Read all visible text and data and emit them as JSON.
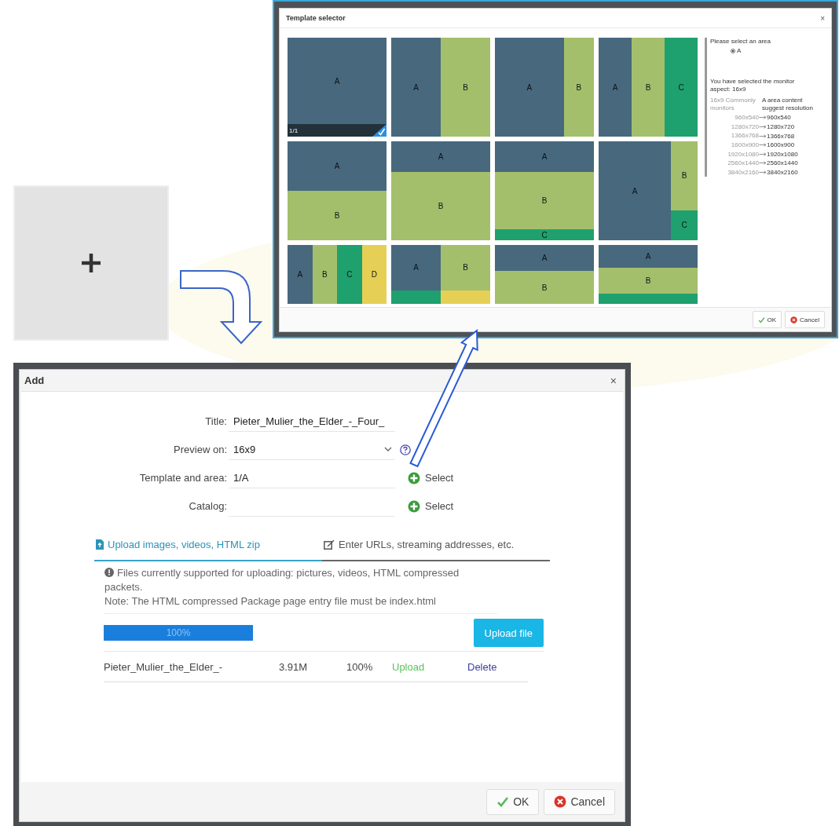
{
  "template_selector": {
    "title": "Template selector",
    "close": "×",
    "templates": [
      {
        "kind": "full",
        "selected": true,
        "badge": "1/1",
        "areas": [
          {
            "label": "A",
            "color": "#48687e"
          }
        ]
      },
      {
        "kind": "halves",
        "selected": false,
        "areas": [
          {
            "label": "A",
            "color": "#48687e"
          },
          {
            "label": "B",
            "color": "#a4bf6b"
          }
        ]
      },
      {
        "kind": "wideleft",
        "selected": false,
        "areas": [
          {
            "label": "A",
            "color": "#48687e"
          },
          {
            "label": "B",
            "color": "#a4bf6b"
          }
        ]
      },
      {
        "kind": "thirds",
        "selected": false,
        "areas": [
          {
            "label": "A",
            "color": "#48687e"
          },
          {
            "label": "B",
            "color": "#a4bf6b"
          },
          {
            "label": "C",
            "color": "#1fa06f"
          }
        ]
      },
      {
        "kind": "stacked",
        "selected": false,
        "areas": [
          {
            "label": "A",
            "color": "#48687e"
          },
          {
            "label": "B",
            "color": "#a4bf6b"
          }
        ]
      },
      {
        "kind": "topbar",
        "selected": false,
        "areas": [
          {
            "label": "A",
            "color": "#48687e"
          },
          {
            "label": "B",
            "color": "#a4bf6b"
          }
        ]
      },
      {
        "kind": "banded",
        "selected": false,
        "areas": [
          {
            "label": "A",
            "color": "#48687e"
          },
          {
            "label": "B",
            "color": "#a4bf6b"
          },
          {
            "label": "C",
            "color": "#1fa06f"
          }
        ]
      },
      {
        "kind": "sidestack",
        "selected": false,
        "areas": [
          {
            "label": "A",
            "color": "#48687e"
          },
          {
            "label": "B",
            "color": "#a4bf6b"
          },
          {
            "label": "C",
            "color": "#1fa06f"
          }
        ]
      },
      {
        "kind": "quarters",
        "selected": false,
        "areas": [
          {
            "label": "A",
            "color": "#48687e"
          },
          {
            "label": "B",
            "color": "#a4bf6b"
          },
          {
            "label": "C",
            "color": "#1fa06f"
          },
          {
            "label": "D",
            "color": "#e6cf55"
          }
        ]
      },
      {
        "kind": "footersplit",
        "selected": false,
        "areas": [
          {
            "label": "A",
            "color": "#48687e"
          },
          {
            "label": "B",
            "color": "#a4bf6b"
          },
          {
            "color": "#1fa06f"
          },
          {
            "color": "#e6cf55"
          }
        ]
      },
      {
        "kind": "upperlower",
        "selected": false,
        "areas": [
          {
            "label": "A",
            "color": "#48687e"
          },
          {
            "label": "B",
            "color": "#a4bf6b"
          }
        ]
      },
      {
        "kind": "threebands",
        "selected": false,
        "areas": [
          {
            "label": "A",
            "color": "#48687e"
          },
          {
            "label": "B",
            "color": "#a4bf6b"
          },
          {
            "color": "#1fa06f"
          }
        ]
      }
    ],
    "area_prompt": "Please select an area",
    "areas": [
      {
        "label": "A",
        "selected": true
      }
    ],
    "aspect_text": "You have selected the monitor aspect: 16x9",
    "resolution_table": {
      "columns": [
        "16x9 Commonly monitors",
        "A area content suggest resolution"
      ],
      "rows": [
        {
          "monitor": "960x540",
          "resolution": "960x540"
        },
        {
          "monitor": "1280x720",
          "resolution": "1280x720"
        },
        {
          "monitor": "1366x768",
          "resolution": "1366x768"
        },
        {
          "monitor": "1600x900",
          "resolution": "1600x900"
        },
        {
          "monitor": "1920x1080",
          "resolution": "1920x1080"
        },
        {
          "monitor": "2560x1440",
          "resolution": "2560x1440"
        },
        {
          "monitor": "3840x2160",
          "resolution": "3840x2160"
        }
      ]
    },
    "buttons": [
      {
        "label": "OK",
        "kind": "ok"
      },
      {
        "label": "Cancel",
        "kind": "cancel"
      }
    ]
  },
  "add_dialog": {
    "title": "Add",
    "close": "×",
    "fields": [
      {
        "label": "Title:",
        "kind": "text",
        "value": "Pieter_Mulier_the_Elder_-_Four_"
      },
      {
        "label": "Preview on:",
        "kind": "select",
        "value": "16x9"
      },
      {
        "label": "Template and area:",
        "kind": "picker",
        "value": "1/A",
        "action": "Select"
      },
      {
        "label": "Catalog:",
        "kind": "picker",
        "action": "Select"
      }
    ],
    "tabs": [
      {
        "label": "Upload images, videos, HTML zip",
        "kind": "upload",
        "selected": true
      },
      {
        "label": "Enter URLs, streaming addresses, etc.",
        "kind": "edit",
        "selected": false
      }
    ],
    "info": "Files currently supported for uploading: pictures, videos, HTML compressed packets.",
    "note": "Note: The HTML compressed Package page entry file must be index.html",
    "progress": {
      "level": 1,
      "reading": "100%"
    },
    "upload_button": "Upload file",
    "files": [
      {
        "name": "Pieter_Mulier_the_Elder_-",
        "size": "3.91M",
        "percent": "100%",
        "status": "Upload",
        "action": "Delete"
      }
    ],
    "buttons": [
      {
        "label": "OK",
        "kind": "ok"
      },
      {
        "label": "Cancel",
        "kind": "cancel"
      }
    ]
  }
}
